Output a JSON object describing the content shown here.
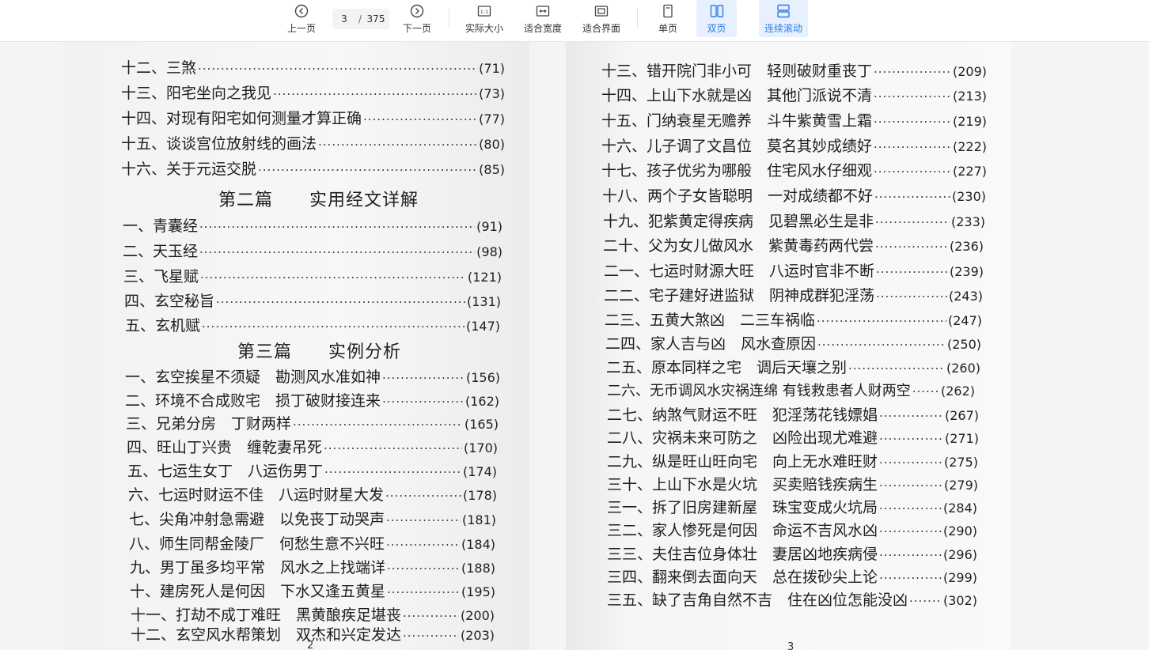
{
  "toolbar": {
    "prev_label": "上一页",
    "next_label": "下一页",
    "current_page": "3",
    "page_separator": "/",
    "total_pages": "375",
    "actual_size_label": "实际大小",
    "fit_width_label": "适合宽度",
    "fit_page_label": "适合界面",
    "single_page_label": "单页",
    "double_page_label": "双页",
    "continuous_scroll_label": "连续滚动",
    "accent_color": "#2d7be5"
  },
  "left_page": {
    "entries": [
      {
        "title": "十二、三煞",
        "page": "(71)"
      },
      {
        "title": "十三、阳宅坐向之我见",
        "page": "(73)"
      },
      {
        "title": "十四、对现有阳宅如何测量才算正确",
        "page": "(77)"
      },
      {
        "title": "十五、谈谈宫位放射线的画法",
        "page": "(80)"
      },
      {
        "title": "十六、关于元运交脱",
        "page": "(85)"
      },
      {
        "title": "一、青囊经",
        "page": "(91)"
      },
      {
        "title": "二、天玉经",
        "page": "(98)"
      },
      {
        "title": "三、飞星赋",
        "page": "(121)"
      },
      {
        "title": "四、玄空秘旨",
        "page": "(131)"
      },
      {
        "title": "五、玄机赋",
        "page": "(147)"
      },
      {
        "title": "一、玄空挨星不须疑　勘测风水准如神",
        "page": "(156)"
      },
      {
        "title": "二、环境不合成败宅　损丁破财接连来",
        "page": "(162)"
      },
      {
        "title": "三、兄弟分房　丁财两样",
        "page": "(165)"
      },
      {
        "title": "四、旺山丁兴贵　缠乾妻吊死",
        "page": "(170)"
      },
      {
        "title": "五、七运生女丁　八运伤男丁",
        "page": "(174)"
      },
      {
        "title": "六、七运时财运不佳　八运时财星大发",
        "page": "(178)"
      },
      {
        "title": "七、尖角冲射急需避　以免丧丁动哭声",
        "page": "(181)"
      },
      {
        "title": "八、师生同帮金陵厂　何愁生意不兴旺",
        "page": "(184)"
      },
      {
        "title": "九、男丁虽多均平常　风水之上找端详",
        "page": "(188)"
      },
      {
        "title": "十、建房死人是何因　下水又逢五黄星",
        "page": "(195)"
      },
      {
        "title": "十一、打劫不成丁难旺　黑黄酿疾足堪丧",
        "page": "(200)"
      },
      {
        "title": "十二、玄空风水帮策划　双杰和兴定发达",
        "page": "(203)"
      }
    ],
    "section_two": "第二篇　　实用经文详解",
    "section_three": "第三篇　　实例分析",
    "page_number": "2"
  },
  "right_page": {
    "entries": [
      {
        "title": "十三、错开院门非小可　轻则破财重丧丁",
        "page": "(209)"
      },
      {
        "title": "十四、上山下水就是凶　其他门派说不清",
        "page": "(213)"
      },
      {
        "title": "十五、门纳衰星无赡养　斗牛紫黄雪上霜",
        "page": "(219)"
      },
      {
        "title": "十六、儿子调了文昌位　莫名其妙成绩好",
        "page": "(222)"
      },
      {
        "title": "十七、孩子优劣为哪般　住宅风水仔细观",
        "page": "(227)"
      },
      {
        "title": "十八、两个子女皆聪明　一对成绩都不好",
        "page": "(230)"
      },
      {
        "title": "十九、犯紫黄定得疾病　见碧黑必生是非",
        "page": "(233)"
      },
      {
        "title": "二十、父为女儿做风水　紫黄毒药两代尝",
        "page": "(236)"
      },
      {
        "title": "二一、七运时财源大旺　八运时官非不断",
        "page": "(239)"
      },
      {
        "title": "二二、宅子建好进监狱　阴神成群犯淫荡",
        "page": "(243)"
      },
      {
        "title": "二三、五黄大煞凶　二三车祸临",
        "page": "(247)"
      },
      {
        "title": "二四、家人吉与凶　风水查原因",
        "page": "(250)"
      },
      {
        "title": "二五、原本同样之宅　调后天壤之别",
        "page": "(260)"
      },
      {
        "title": "二六、无币调风水灾祸连绵 有钱救患者人财两空",
        "page": "(262)"
      },
      {
        "title": "二七、纳煞气财运不旺　犯淫荡花钱嫖娼",
        "page": "(267)"
      },
      {
        "title": "二八、灾祸未来可防之　凶险出现尤难避",
        "page": "(271)"
      },
      {
        "title": "二九、纵是旺山旺向宅　向上无水难旺财",
        "page": "(275)"
      },
      {
        "title": "三十、上山下水是火坑　买卖赔钱疾病生",
        "page": "(279)"
      },
      {
        "title": "三一、拆了旧房建新屋　珠宝变成火坑局",
        "page": "(284)"
      },
      {
        "title": "三二、家人惨死是何因　命运不吉风水凶",
        "page": "(290)"
      },
      {
        "title": "三三、夫住吉位身体壮　妻居凶地疾病侵",
        "page": "(296)"
      },
      {
        "title": "三四、翻来倒去面向天　总在拨砂尖上论",
        "page": "(299)"
      },
      {
        "title": "三五、缺了吉角自然不吉　住在凶位怎能没凶",
        "page": "(302)"
      }
    ],
    "page_number": "3"
  }
}
